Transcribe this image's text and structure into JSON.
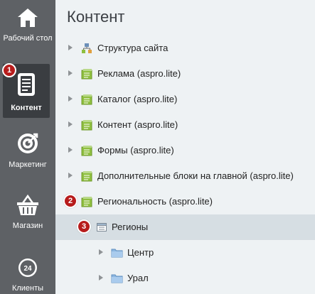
{
  "sidebar": {
    "items": [
      {
        "label": "Рабочий стол",
        "icon": "home-icon"
      },
      {
        "label": "Контент",
        "icon": "document-icon",
        "active": true
      },
      {
        "label": "Маркетинг",
        "icon": "target-icon"
      },
      {
        "label": "Магазин",
        "icon": "basket-icon"
      },
      {
        "label": "Клиенты",
        "icon": "clients-icon",
        "icon_text": "24"
      }
    ]
  },
  "main": {
    "title": "Контент",
    "tree": [
      {
        "label": "Структура сайта",
        "icon": "site-structure-icon"
      },
      {
        "label": "Реклама (aspro.lite)",
        "icon": "iblock-icon"
      },
      {
        "label": "Каталог (aspro.lite)",
        "icon": "iblock-icon"
      },
      {
        "label": "Контент (aspro.lite)",
        "icon": "iblock-icon"
      },
      {
        "label": "Формы (aspro.lite)",
        "icon": "iblock-icon"
      },
      {
        "label": "Дополнительные блоки на главной (aspro.lite)",
        "icon": "iblock-icon"
      },
      {
        "label": "Региональность (aspro.lite)",
        "icon": "iblock-icon"
      },
      {
        "label": "Регионы",
        "icon": "list-icon",
        "selected": true
      },
      {
        "label": "Центр",
        "icon": "folder-icon"
      },
      {
        "label": "Урал",
        "icon": "folder-icon"
      }
    ]
  },
  "badges": [
    "1",
    "2",
    "3"
  ],
  "colors": {
    "sidebar_bg": "#5e6165",
    "sidebar_active_bg": "#3a3d41",
    "main_bg": "#eef2f4",
    "selected_row_bg": "#d6dee3",
    "badge_bg": "#b71c1c",
    "iblock_icon": "#8fbf3f",
    "folder_icon": "#8db7e0"
  }
}
